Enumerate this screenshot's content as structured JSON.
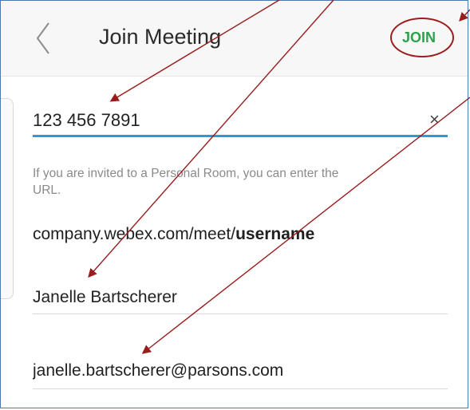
{
  "header": {
    "title": "Join Meeting",
    "join_label": "JOIN"
  },
  "form": {
    "meeting_number": "123 456 7891",
    "clear_label": "×",
    "hint": "If you are invited to a Personal Room, you can enter the URL.",
    "url_prefix": "company.webex.com/meet/",
    "url_username": "username",
    "name_value": "Janelle Bartscherer",
    "email_value": "janelle.bartscherer@parsons.com"
  },
  "colors": {
    "join_green": "#2ca24a",
    "focus_blue": "#2b9ad8",
    "annotation_red": "#9b1c1c"
  },
  "icons": {
    "back": "chevron-left-icon",
    "clear": "close-icon"
  }
}
